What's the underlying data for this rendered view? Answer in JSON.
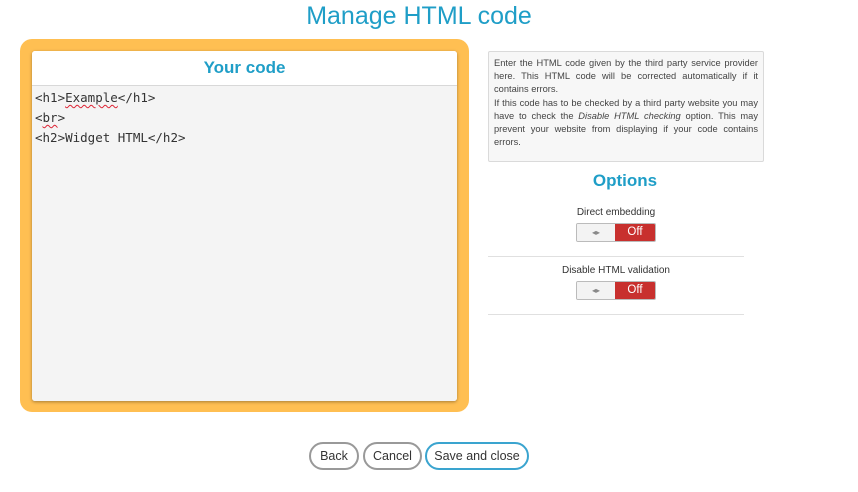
{
  "page": {
    "title": "Manage HTML code"
  },
  "code_panel": {
    "header": "Your code",
    "lines": [
      "<h1>Example</h1>",
      "<br>",
      "<h2>Widget HTML</h2>"
    ]
  },
  "info": {
    "paragraph1": "Enter the HTML code given by the third party service provider here. This HTML code will be corrected automatically if it contains errors.",
    "paragraph2_part1": "If this code has to be checked by a third party website you may have to check the ",
    "paragraph2_emphasis": "Disable HTML checking",
    "paragraph2_part2": " option. This may prevent your website from displaying if your code contains errors."
  },
  "options": {
    "title": "Options",
    "items": [
      {
        "label": "Direct embedding",
        "state_label": "Off",
        "on": false
      },
      {
        "label": "Disable HTML validation",
        "state_label": "Off",
        "on": false
      }
    ],
    "handle_glyph": "◂▸"
  },
  "buttons": {
    "back": "Back",
    "cancel": "Cancel",
    "save_close": "Save and close"
  },
  "colors": {
    "accent": "#1f9ec7",
    "panel_frame": "#ffbf52",
    "toggle_off": "#c8302e",
    "primary_button_border": "#3aa4cf"
  }
}
